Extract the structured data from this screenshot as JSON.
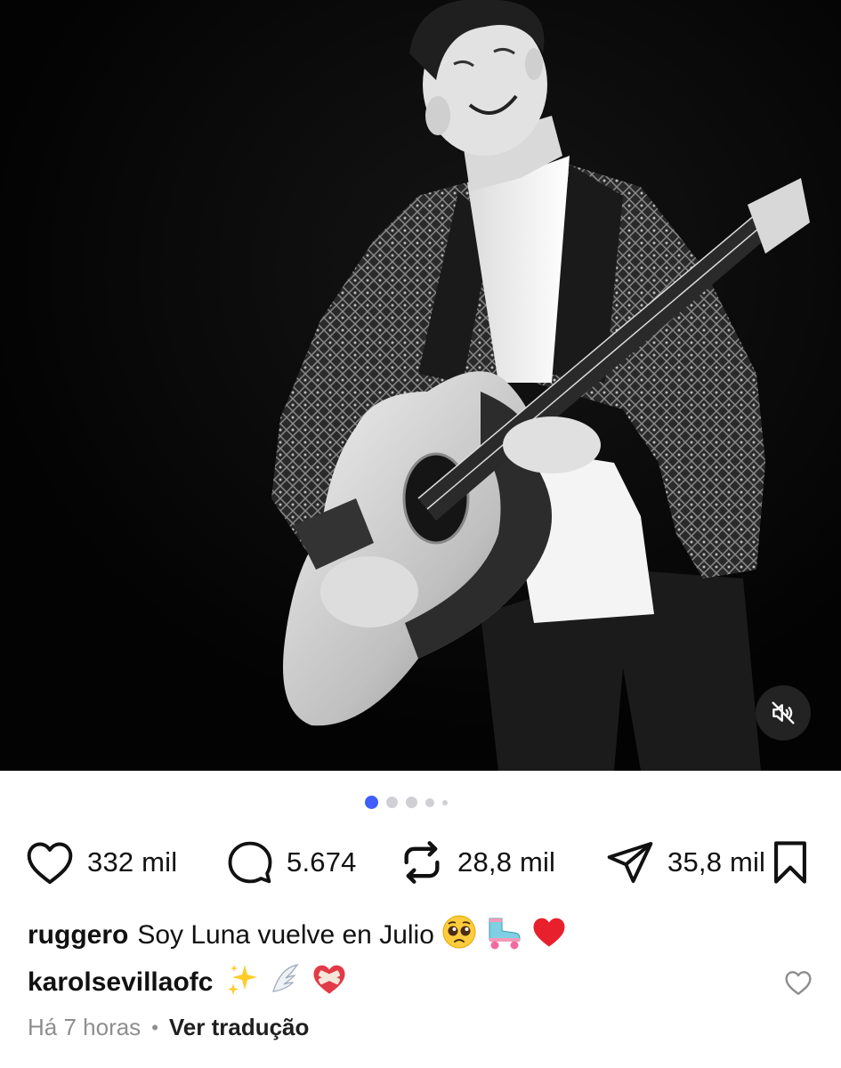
{
  "post": {
    "carousel": {
      "total": 5,
      "active_index": 0
    },
    "mute_button_icon": "speaker-muted-icon",
    "actions": {
      "like_count": "332 mil",
      "comment_count": "5.674",
      "repost_count": "28,8 mil",
      "share_count": "35,8 mil"
    },
    "caption": {
      "username": "ruggero",
      "text": "Soy Luna vuelve en Julio",
      "emojis": [
        "pleading-face-emoji",
        "roller-skate-emoji",
        "red-heart-emoji"
      ]
    },
    "comment": {
      "username": "karolsevillaofc",
      "emojis": [
        "sparkles-emoji",
        "wing-emoji",
        "mending-heart-emoji"
      ]
    },
    "meta": {
      "time": "Há 7 horas",
      "separator": "•",
      "translate_label": "Ver tradução"
    },
    "colors": {
      "accent": "#3f5efb",
      "heart": "#e8202e",
      "muted_text": "#8e8e8e"
    }
  }
}
